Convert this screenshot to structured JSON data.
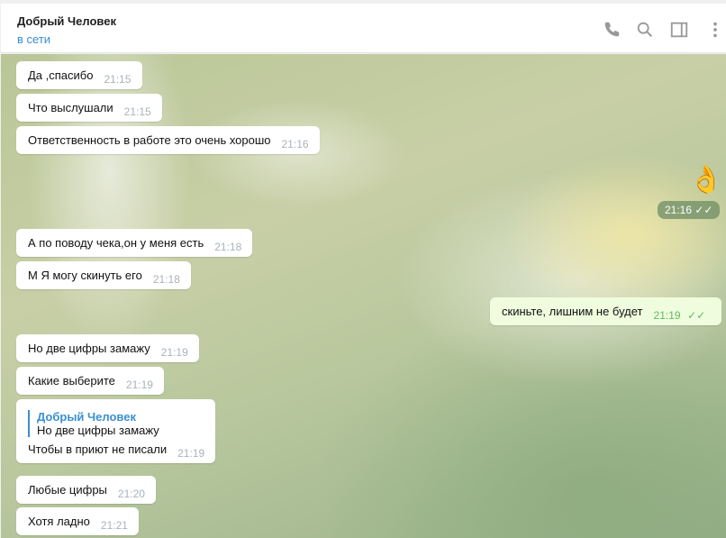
{
  "header": {
    "title": "Добрый Человек",
    "status": "в сети"
  },
  "messages": [
    {
      "text": "Да ,спасибо",
      "time": "21:15"
    },
    {
      "text": "Что выслушали",
      "time": "21:15"
    },
    {
      "text": "Ответственность в работе это очень хорошо",
      "time": "21:16"
    },
    {
      "emoji": "👌",
      "time": "21:16"
    },
    {
      "text": "А по поводу чека,он у меня есть",
      "time": "21:18"
    },
    {
      "text": "М Я могу скинуть его",
      "time": "21:18"
    },
    {
      "text": "скиньте, лишним не будет",
      "time": "21:19"
    },
    {
      "text": "Но две цифры замажу",
      "time": "21:19"
    },
    {
      "text": "Какие выберите",
      "time": "21:19"
    },
    {
      "reply_name": "Добрый Человек",
      "reply_text": "Но две цифры замажу",
      "text": "Чтобы в приют не писали",
      "time": "21:19"
    },
    {
      "text": "Любые цифры",
      "time": "21:20"
    },
    {
      "text": "Хотя ладно",
      "time": "21:21"
    }
  ]
}
